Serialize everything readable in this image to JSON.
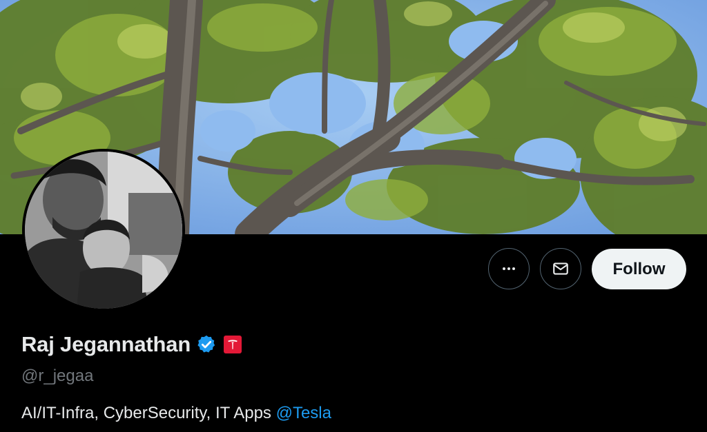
{
  "profile": {
    "display_name": "Raj Jegannathan",
    "handle": "@r_jegaa",
    "bio_text": "AI/IT-Infra, CyberSecurity, IT Apps ",
    "bio_mention": "@Tesla",
    "verified": true
  },
  "actions": {
    "more_icon": "more-horizontal-icon",
    "message_icon": "envelope-icon",
    "follow_label": "Follow"
  },
  "colors": {
    "background": "#000000",
    "text_primary": "#e7e9ea",
    "text_secondary": "#71767b",
    "accent_blue": "#1d9bf0",
    "follow_button_bg": "#eff3f4",
    "tesla_red": "#e31937",
    "button_border": "#536471"
  }
}
